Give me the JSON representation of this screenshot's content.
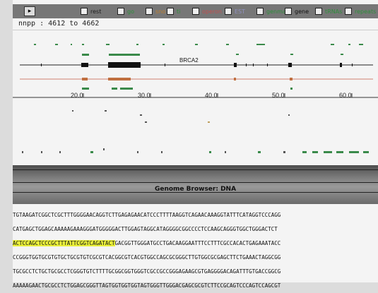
{
  "toolbar": {
    "button_glyph": "▸",
    "legend": [
      {
        "label": "rest",
        "color": "#222222"
      },
      {
        "label": "go",
        "color": "#2f8f3c"
      },
      {
        "label": "sno",
        "color": "#c08030"
      },
      {
        "label": "ti",
        "color": "#2f8f3c"
      },
      {
        "label": "operon",
        "color": "#c05050"
      },
      {
        "label": "EST",
        "color": "#9090c0"
      },
      {
        "label": "genmap",
        "color": "#2f8f3c"
      },
      {
        "label": "gene",
        "color": "#111111"
      },
      {
        "label": "tRNAs",
        "color": "#2f8f3c"
      },
      {
        "label": "repeats",
        "color": "#2f8f3c"
      }
    ]
  },
  "coordinate_field": {
    "value": "nnpp : 4612 to 4662"
  },
  "gene_track": {
    "label": "BRCA2"
  },
  "ruler": {
    "ticks": [
      "20.0",
      "30.0",
      "40.0",
      "50.0",
      "60.0"
    ]
  },
  "dna_panel": {
    "title": "Genome Browser: DNA",
    "sequence_lines": [
      {
        "pre": "",
        "highlight": "",
        "post": "TGTAAGATCGGCTCGCTTTGGGGAACAGGTCTTGAGAGAACATCCCTTTTAAGGTCAGAACAAAGGTATTTCATAGGTCCCAGG"
      },
      {
        "pre": "",
        "highlight": "",
        "post": "CATGAGCTGGAGCAAAAAGAAAGGGATGGGGGACTTGGAGTAGGCATAGGGGCGGCCCCTCCAAGCAGGGTGGCTGGGACTCT"
      },
      {
        "pre": "",
        "highlight": "ACTCCAGCTCCCGCTTTATTCGGTCAGATACT",
        "post": "GACGGTTGGGATGCCTGACAAGGAATTTCCTTTCGCCACACTGAGAAATACC"
      },
      {
        "pre": "",
        "highlight": "",
        "post": "CCGGGTGGTGCGTGTGCTGCGTGTCGCGTCACGGCGTCACGTGGCCAGCGCGGGCTTGTGGCGCGAGCTTCTGAAACTAGGCGG"
      },
      {
        "pre": "",
        "highlight": "",
        "post": "TGCGCCTCTGCTGCGCCTCGGGTGTCTTTTGCGGCGGTGGGTCGCCGCCGGGAGAAGCGTGAGGGGACAGATTTGTGACCGGCG"
      },
      {
        "pre": "",
        "highlight": "",
        "post": "AAAAAGAACTGCGCCTCTGGAGCGGGTTAGTGGTGGTGGTAGTGGGTTGGGACGAGCGCGTCTTCCGCAGTCCCAGTCCAGCGT"
      }
    ]
  }
}
